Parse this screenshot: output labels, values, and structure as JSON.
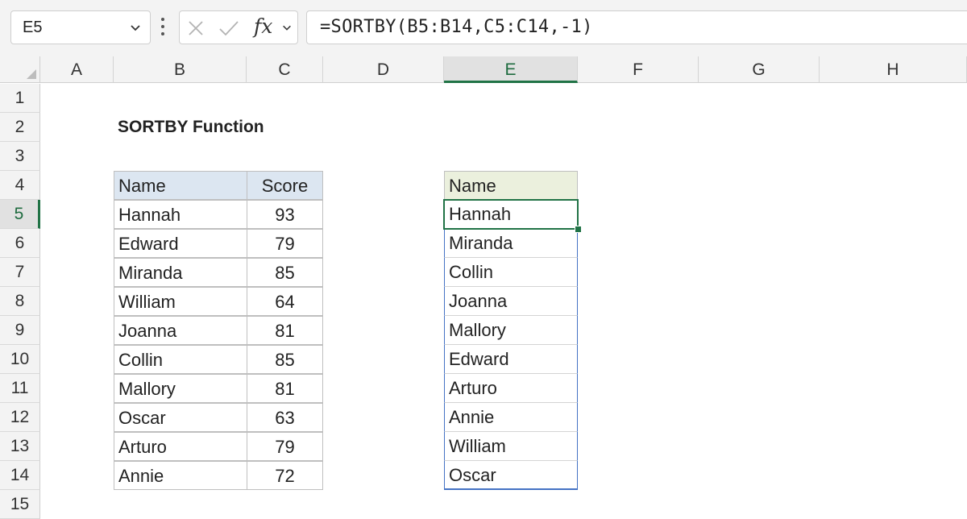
{
  "name_box": {
    "value": "E5"
  },
  "formula_bar": {
    "fx_label": "fx",
    "formula": "=SORTBY(B5:B14,C5:C14,-1)"
  },
  "columns": [
    "A",
    "B",
    "C",
    "D",
    "E",
    "F",
    "G",
    "H"
  ],
  "rows": [
    "1",
    "2",
    "3",
    "4",
    "5",
    "6",
    "7",
    "8",
    "9",
    "10",
    "11",
    "12",
    "13",
    "14",
    "15"
  ],
  "selected": {
    "column": "E",
    "row": "5"
  },
  "sheet": {
    "title": "SORTBY Function",
    "source_table": {
      "headers": [
        "Name",
        "Score"
      ],
      "rows": [
        [
          "Hannah",
          "93"
        ],
        [
          "Edward",
          "79"
        ],
        [
          "Miranda",
          "85"
        ],
        [
          "William",
          "64"
        ],
        [
          "Joanna",
          "81"
        ],
        [
          "Collin",
          "85"
        ],
        [
          "Mallory",
          "81"
        ],
        [
          "Oscar",
          "63"
        ],
        [
          "Arturo",
          "79"
        ],
        [
          "Annie",
          "72"
        ]
      ]
    },
    "result_table": {
      "header": "Name",
      "values": [
        "Hannah",
        "Miranda",
        "Collin",
        "Joanna",
        "Mallory",
        "Edward",
        "Arturo",
        "Annie",
        "William",
        "Oscar"
      ]
    }
  },
  "colors": {
    "accent": "#217346",
    "spill_border": "#4472c4",
    "header_blue": "#dce6f1",
    "header_green": "#ebf0dd"
  }
}
